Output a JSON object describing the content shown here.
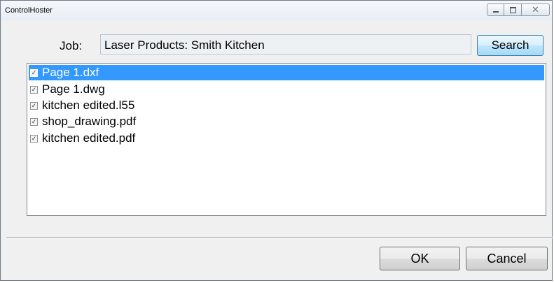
{
  "window": {
    "title": "ControlHoster",
    "minimize_label": "",
    "maximize_label": "",
    "close_label": "✕"
  },
  "job": {
    "label": "Job:",
    "value": "Laser Products: Smith Kitchen"
  },
  "search_button": {
    "label": "Search"
  },
  "files": [
    {
      "name": "Page 1.dxf",
      "checked": true,
      "selected": true
    },
    {
      "name": "Page 1.dwg",
      "checked": true,
      "selected": false
    },
    {
      "name": "kitchen edited.l55",
      "checked": true,
      "selected": false
    },
    {
      "name": "shop_drawing.pdf",
      "checked": true,
      "selected": false
    },
    {
      "name": "kitchen edited.pdf",
      "checked": true,
      "selected": false
    }
  ],
  "buttons": {
    "ok": "OK",
    "cancel": "Cancel"
  },
  "colors": {
    "selection": "#3399ff",
    "search_button": "#bee6fd"
  }
}
